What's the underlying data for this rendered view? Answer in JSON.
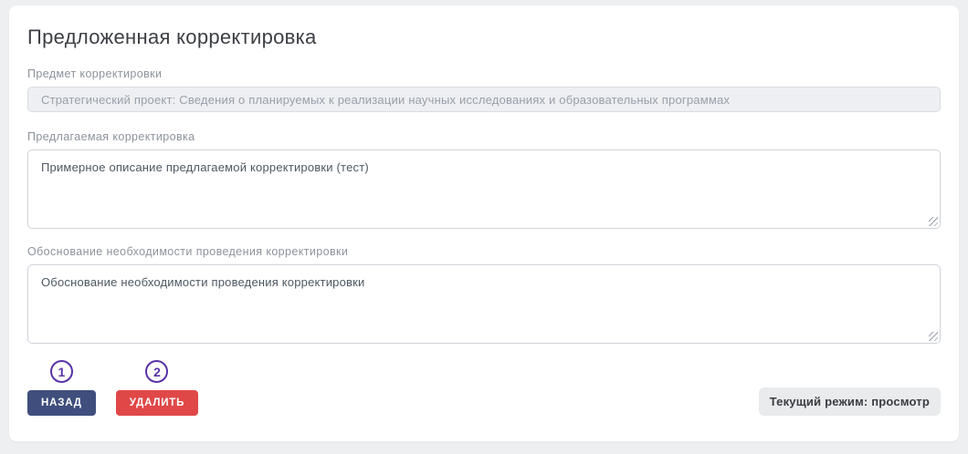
{
  "page": {
    "title": "Предложенная корректировка"
  },
  "fields": {
    "subject": {
      "label": "Предмет корректировки",
      "value": "Стратегический проект: Сведения о планируемых к реализации научных исследованиях и образовательных программах",
      "state": "disabled"
    },
    "proposal": {
      "label": "Предлагаемая корректировка",
      "value": "Примерное описание предлагаемой корректировки (тест)"
    },
    "justification": {
      "label": "Обоснование необходимости проведения корректировки",
      "value": "Обоснование необходимости проведения корректировки"
    }
  },
  "actions": {
    "back": {
      "label": "НАЗАД",
      "annotation": "1"
    },
    "delete": {
      "label": "УДАЛИТЬ",
      "annotation": "2"
    }
  },
  "status": {
    "mode_badge": "Текущий режим: просмотр"
  },
  "colors": {
    "back_button": "#3f4e7d",
    "delete_button": "#e04848",
    "annotation": "#5733a6",
    "page_background": "#edeff1",
    "disabled_input_background": "#edeff2"
  }
}
